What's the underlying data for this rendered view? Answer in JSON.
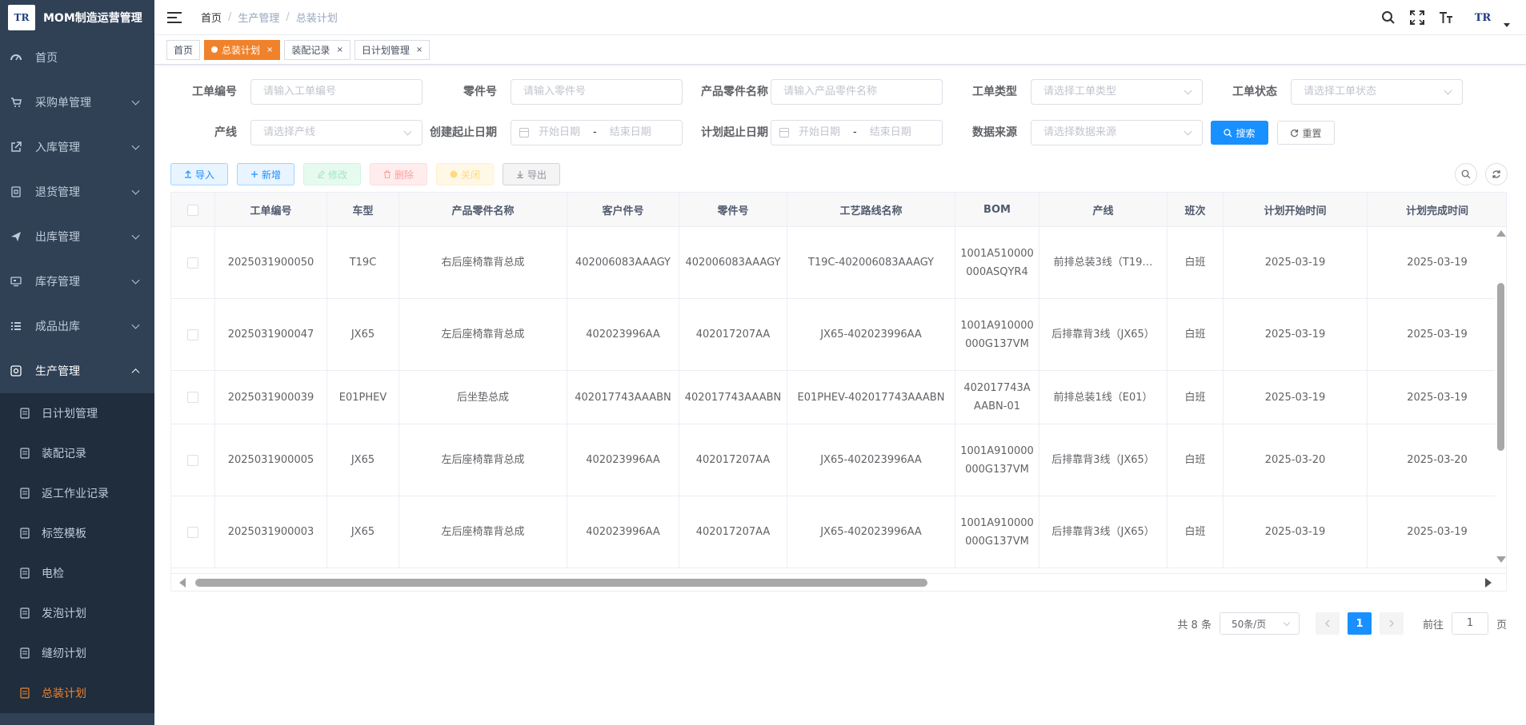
{
  "app": {
    "title": "MOM制造运营管理",
    "logo_text": "TR"
  },
  "sidebar": {
    "items": [
      {
        "label": "首页",
        "icon": "dashboard-icon"
      },
      {
        "label": "采购单管理",
        "icon": "cart-icon"
      },
      {
        "label": "入库管理",
        "icon": "external-link-icon"
      },
      {
        "label": "退货管理",
        "icon": "return-box-icon"
      },
      {
        "label": "出库管理",
        "icon": "send-icon"
      },
      {
        "label": "库存管理",
        "icon": "monitor-icon"
      },
      {
        "label": "成品出库",
        "icon": "list-icon"
      },
      {
        "label": "生产管理",
        "icon": "production-icon"
      }
    ],
    "submenu": [
      {
        "label": "日计划管理"
      },
      {
        "label": "装配记录"
      },
      {
        "label": "返工作业记录"
      },
      {
        "label": "标签模板"
      },
      {
        "label": "电检"
      },
      {
        "label": "发泡计划"
      },
      {
        "label": "缝纫计划"
      },
      {
        "label": "总装计划"
      }
    ]
  },
  "breadcrumb": [
    "首页",
    "生产管理",
    "总装计划"
  ],
  "tags": [
    {
      "label": "首页"
    },
    {
      "label": "总装计划"
    },
    {
      "label": "装配记录"
    },
    {
      "label": "日计划管理"
    }
  ],
  "filters": {
    "work_order_no": {
      "label": "工单编号",
      "placeholder": "请输入工单编号"
    },
    "part_no": {
      "label": "零件号",
      "placeholder": "请输入零件号"
    },
    "part_name": {
      "label": "产品零件名称",
      "placeholder": "请输入产品零件名称"
    },
    "order_type": {
      "label": "工单类型",
      "placeholder": "请选择工单类型"
    },
    "order_status": {
      "label": "工单状态",
      "placeholder": "请选择工单状态"
    },
    "line": {
      "label": "产线",
      "placeholder": "请选择产线"
    },
    "create_date": {
      "label": "创建起止日期",
      "start": "开始日期",
      "sep": "-",
      "end": "结束日期"
    },
    "plan_date": {
      "label": "计划起止日期",
      "start": "开始日期",
      "sep": "-",
      "end": "结束日期"
    },
    "data_source": {
      "label": "数据来源",
      "placeholder": "请选择数据来源"
    },
    "search_label": "搜索",
    "reset_label": "重置"
  },
  "toolbar": {
    "import": "导入",
    "add": "新增",
    "edit": "修改",
    "delete": "删除",
    "close": "关闭",
    "export": "导出"
  },
  "table": {
    "headers": [
      "工单编号",
      "车型",
      "产品零件名称",
      "客户件号",
      "零件号",
      "工艺路线名称",
      "BOM",
      "产线",
      "班次",
      "计划开始时间",
      "计划完成时间"
    ],
    "rows": [
      [
        "2025031900050",
        "T19C",
        "右后座椅靠背总成",
        "402006083AAAGY",
        "402006083AAAGY",
        "T19C-402006083AAAGY",
        "1001A510000000ASQYR4",
        "前排总装3线（T19…",
        "白班",
        "2025-03-19",
        "2025-03-19"
      ],
      [
        "2025031900047",
        "JX65",
        "左后座椅靠背总成",
        "402023996AA",
        "402017207AA",
        "JX65-402023996AA",
        "1001A910000000G137VM",
        "后排靠背3线（JX65）",
        "白班",
        "2025-03-19",
        "2025-03-19"
      ],
      [
        "2025031900039",
        "E01PHEV",
        "后坐垫总成",
        "402017743AAABN",
        "402017743AAABN",
        "E01PHEV-402017743AAABN",
        "402017743AAABN-01",
        "前排总装1线（E01）",
        "白班",
        "2025-03-19",
        "2025-03-19"
      ],
      [
        "2025031900005",
        "JX65",
        "左后座椅靠背总成",
        "402023996AA",
        "402017207AA",
        "JX65-402023996AA",
        "1001A910000000G137VM",
        "后排靠背3线（JX65）",
        "白班",
        "2025-03-20",
        "2025-03-20"
      ],
      [
        "2025031900003",
        "JX65",
        "左后座椅靠背总成",
        "402023996AA",
        "402017207AA",
        "JX65-402023996AA",
        "1001A910000000G137VM",
        "后排靠背3线（JX65）",
        "白班",
        "2025-03-19",
        "2025-03-19"
      ]
    ]
  },
  "pagination": {
    "total": "共 8 条",
    "page_size": "50条/页",
    "current": "1",
    "goto_label": "前往",
    "goto_value": "1",
    "page_suffix": "页"
  },
  "colors": {
    "sidebar_bg": "#304156",
    "submenu_bg": "#1f2d3d",
    "accent_orange": "#f0822b",
    "primary_blue": "#1890ff"
  }
}
